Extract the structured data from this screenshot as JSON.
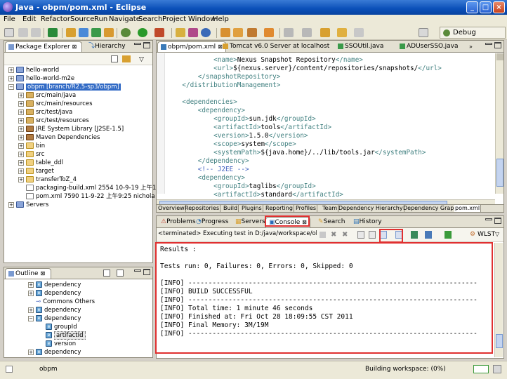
{
  "window": {
    "title": "Java - obpm/pom.xml - Eclipse"
  },
  "menu": [
    "File",
    "Edit",
    "Refactor",
    "Source",
    "Run",
    "Navigate",
    "Search",
    "Project",
    "Window",
    "Help"
  ],
  "toolbar": {
    "perspective_label": "Debug"
  },
  "package_explorer": {
    "tabs": [
      "Package Explorer",
      "Hierarchy"
    ],
    "items": [
      {
        "label": "hello-world",
        "indent": 0,
        "icon": "project-icon",
        "expanded": false
      },
      {
        "label": "hello-world-m2e",
        "indent": 0,
        "icon": "project-icon",
        "expanded": false
      },
      {
        "label": "obpm [branch/R2.5-sp3/obpm]",
        "indent": 0,
        "icon": "project-icon",
        "expanded": true,
        "selected": true
      },
      {
        "label": "src/main/java",
        "indent": 1,
        "icon": "package-folder-icon",
        "expanded": false
      },
      {
        "label": "src/main/resources",
        "indent": 1,
        "icon": "package-folder-icon",
        "expanded": false
      },
      {
        "label": "src/test/java",
        "indent": 1,
        "icon": "package-folder-icon",
        "expanded": false
      },
      {
        "label": "src/test/resources",
        "indent": 1,
        "icon": "package-folder-icon",
        "expanded": false
      },
      {
        "label": "JRE System Library [J2SE-1.5]",
        "indent": 1,
        "icon": "library-icon",
        "expanded": false
      },
      {
        "label": "Maven Dependencies",
        "indent": 1,
        "icon": "library-icon",
        "expanded": false
      },
      {
        "label": "bin",
        "indent": 1,
        "icon": "folder-icon",
        "expanded": false
      },
      {
        "label": "src",
        "indent": 1,
        "icon": "folder-icon",
        "expanded": false
      },
      {
        "label": "table_ddl",
        "indent": 1,
        "icon": "folder-icon",
        "expanded": false
      },
      {
        "label": "target",
        "indent": 1,
        "icon": "folder-icon",
        "expanded": false
      },
      {
        "label": "transferToZ_4",
        "indent": 1,
        "icon": "folder-icon",
        "expanded": false
      },
      {
        "label": "packaging-build.xml 2554  10-9-19 上午1",
        "indent": 1,
        "icon": "file-icon",
        "leaf": true
      },
      {
        "label": "pom.xml 7590  11-9-22 上午9:25  nichola",
        "indent": 1,
        "icon": "file-icon",
        "leaf": true
      },
      {
        "label": "Servers",
        "indent": 0,
        "icon": "project-icon",
        "expanded": false
      }
    ]
  },
  "outline": {
    "title": "Outline",
    "items": [
      {
        "label": "dependency",
        "indent": 0,
        "expanded": false
      },
      {
        "label": "dependency",
        "indent": 0,
        "expanded": false
      },
      {
        "label": "Commons Others",
        "indent": 0,
        "comment": true
      },
      {
        "label": "dependency",
        "indent": 0,
        "expanded": false
      },
      {
        "label": "dependency",
        "indent": 0,
        "expanded": true
      },
      {
        "label": "groupId",
        "indent": 1
      },
      {
        "label": "artifactId",
        "indent": 1,
        "selected": true
      },
      {
        "label": "version",
        "indent": 1
      },
      {
        "label": "dependency",
        "indent": 0,
        "expanded": false
      }
    ]
  },
  "editor": {
    "tabs": [
      "obpm/pom.xml",
      "Tomcat v6.0 Server at localhost",
      "SSOUtil.java",
      "ADUserSSO.java"
    ],
    "lines": [
      {
        "indent": "            ",
        "parts": [
          [
            "tag",
            "<name>"
          ],
          [
            "txt",
            "Nexus Snapshot Repository"
          ],
          [
            "tag",
            "</name>"
          ]
        ]
      },
      {
        "indent": "            ",
        "parts": [
          [
            "tag",
            "<url>"
          ],
          [
            "txt",
            "${nexus.server}/content/repositories/snapshots/"
          ],
          [
            "tag",
            "</url>"
          ]
        ]
      },
      {
        "indent": "        ",
        "parts": [
          [
            "tag",
            "</snapshotRepository>"
          ]
        ]
      },
      {
        "indent": "    ",
        "parts": [
          [
            "tag",
            "</distributionManagement>"
          ]
        ]
      },
      {
        "indent": "",
        "parts": []
      },
      {
        "indent": "    ",
        "parts": [
          [
            "tag",
            "<dependencies>"
          ]
        ]
      },
      {
        "indent": "        ",
        "parts": [
          [
            "tag",
            "<dependency>"
          ]
        ]
      },
      {
        "indent": "            ",
        "parts": [
          [
            "tag",
            "<groupId>"
          ],
          [
            "txt",
            "sun.jdk"
          ],
          [
            "tag",
            "</groupId>"
          ]
        ]
      },
      {
        "indent": "            ",
        "parts": [
          [
            "tag",
            "<artifactId>"
          ],
          [
            "txt",
            "tools"
          ],
          [
            "tag",
            "</artifactId>"
          ]
        ]
      },
      {
        "indent": "            ",
        "parts": [
          [
            "tag",
            "<version>"
          ],
          [
            "txt",
            "1.5.0"
          ],
          [
            "tag",
            "</version>"
          ]
        ]
      },
      {
        "indent": "            ",
        "parts": [
          [
            "tag",
            "<scope>"
          ],
          [
            "txt",
            "system"
          ],
          [
            "tag",
            "</scope>"
          ]
        ]
      },
      {
        "indent": "            ",
        "parts": [
          [
            "tag",
            "<systemPath>"
          ],
          [
            "txt",
            "${java.home}/../lib/tools.jar"
          ],
          [
            "tag",
            "</systemPath>"
          ]
        ]
      },
      {
        "indent": "        ",
        "parts": [
          [
            "tag",
            "</dependency>"
          ]
        ]
      },
      {
        "indent": "        ",
        "parts": [
          [
            "cmt",
            "<!-- J2EE -->"
          ]
        ]
      },
      {
        "indent": "        ",
        "parts": [
          [
            "tag",
            "<dependency>"
          ]
        ]
      },
      {
        "indent": "            ",
        "parts": [
          [
            "tag",
            "<groupId>"
          ],
          [
            "txt",
            "taglibs"
          ],
          [
            "tag",
            "</groupId>"
          ]
        ]
      },
      {
        "indent": "            ",
        "parts": [
          [
            "tag",
            "<artifactId>"
          ],
          [
            "txt",
            "standard"
          ],
          [
            "tag",
            "</artifactId>"
          ]
        ]
      }
    ],
    "bottom_tabs": [
      "Overview",
      "Repositories",
      "Build",
      "Plugins",
      "Reporting",
      "Profiles",
      "Team",
      "Dependency Hierarchy",
      "Dependency Graph",
      "pom.xml"
    ]
  },
  "console": {
    "tabs": [
      "Problems",
      "Progress",
      "Servers",
      "Console",
      "Search",
      "History"
    ],
    "status": "<terminated> Executing test in D:/java/workspace/obpm",
    "wlst_label": "WLST",
    "lines": [
      "Results :",
      "",
      "Tests run: 0, Failures: 0, Errors: 0, Skipped: 0",
      "",
      "[INFO] ------------------------------------------------------------------------",
      "[INFO] BUILD SUCCESSFUL",
      "[INFO] ------------------------------------------------------------------------",
      "[INFO] Total time: 1 minute 46 seconds",
      "[INFO] Finished at: Fri Oct 28 18:09:55 CST 2011",
      "[INFO] Final Memory: 3M/19M",
      "[INFO] ------------------------------------------------------------------------"
    ]
  },
  "statusbar": {
    "project": "obpm",
    "build_status": "Building workspace: (0%)",
    "build_progress": 0
  },
  "colors": {
    "title_bar": "#0a4fb8",
    "highlight": "#e03030",
    "selection": "#316ac5",
    "xml_tag": "#3f7f7f",
    "xml_comment": "#3f5fbf"
  }
}
